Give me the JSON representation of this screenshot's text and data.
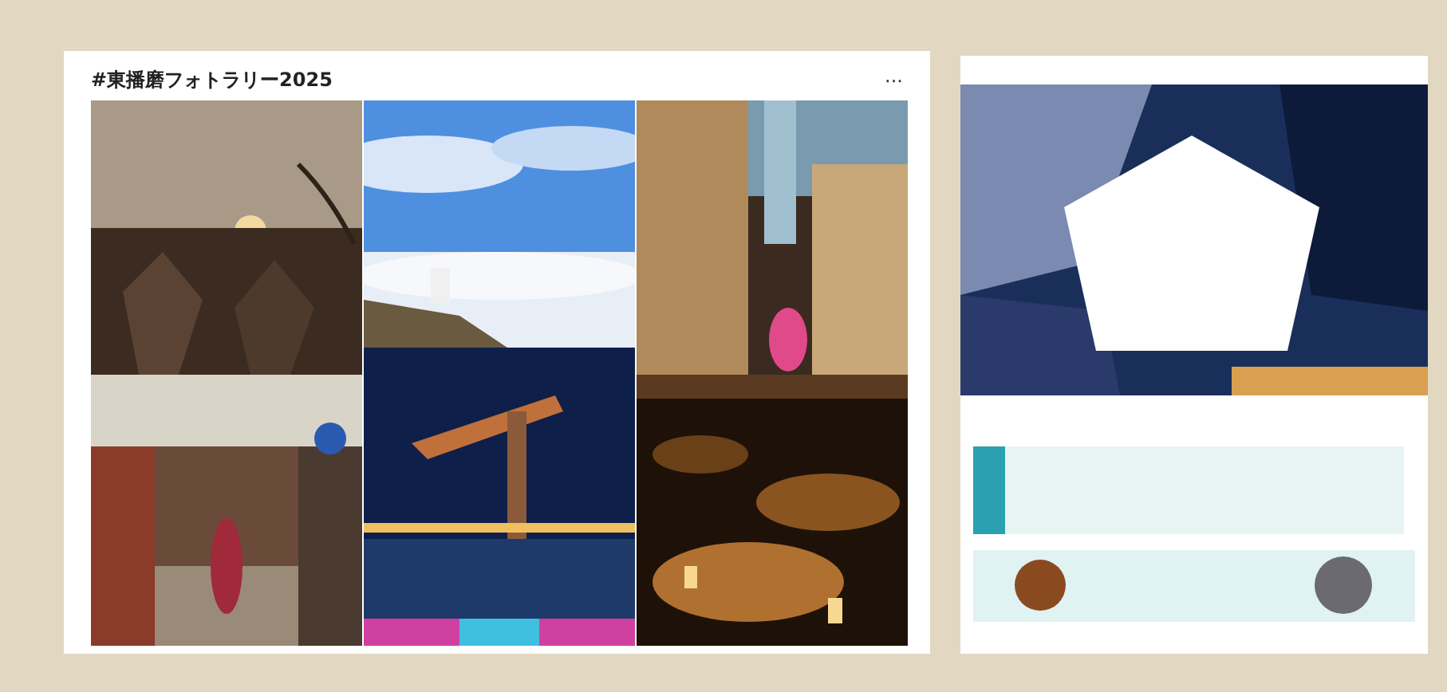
{
  "post": {
    "title": "#東播磨フォトラリー2025",
    "menu": "···"
  }
}
